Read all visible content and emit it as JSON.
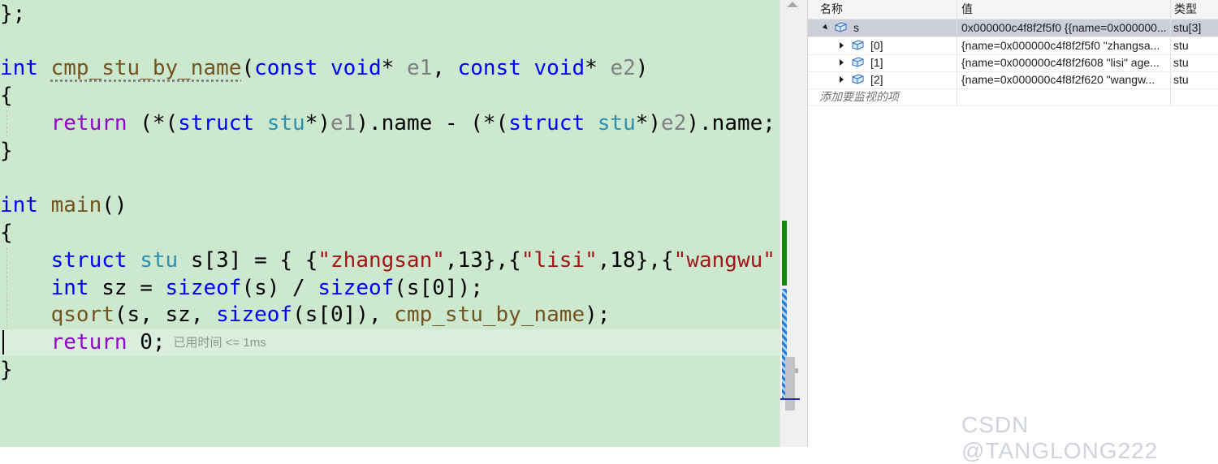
{
  "code": {
    "l0": "};",
    "l2_type": "int",
    "l2_fn": "cmp_stu_by_name",
    "l2_open": "(",
    "l2_const1": "const",
    "l2_void1": "void",
    "l2_star1": "* ",
    "l2_e1": "e1",
    "l2_comma": ", ",
    "l2_const2": "const",
    "l2_void2": "void",
    "l2_star2": "* ",
    "l2_e2": "e2",
    "l2_close": ")",
    "l3": "{",
    "l4_return": "return",
    "l4_a": " (*(",
    "l4_struct1": "struct",
    "l4_stu1": "stu",
    "l4_b": "*)",
    "l4_e1": "e1",
    "l4_c": ").name - (*(",
    "l4_struct2": "struct",
    "l4_stu2": "stu",
    "l4_d": "*)",
    "l4_e2": "e2",
    "l4_e": ").name;",
    "l5": "}",
    "l7_type": "int",
    "l7_fn": "main",
    "l7_rest": "()",
    "l8": "{",
    "l9_struct": "struct",
    "l9_stu": "stu",
    "l9_a": " s[3] = { {",
    "l9_s1": "\"zhangsan\"",
    "l9_b": ",13},{",
    "l9_s2": "\"lisi\"",
    "l9_c": ",18},{",
    "l9_s3": "\"wangwu\"",
    "l10_type": "int",
    "l10_a": " sz = ",
    "l10_sizeof1": "sizeof",
    "l10_b": "(s) / ",
    "l10_sizeof2": "sizeof",
    "l10_c": "(s[0]);",
    "l11_fn": "qsort",
    "l11_a": "(s, sz, ",
    "l11_sizeof": "sizeof",
    "l11_b": "(s[0]), ",
    "l11_cmp": "cmp_stu_by_name",
    "l11_c": ");",
    "l12_return": "return",
    "l12_rest": " 0;",
    "l12_hint": "已用时间 <= 1ms",
    "l13": "}"
  },
  "watch": {
    "columns": {
      "name": "名称",
      "value": "值",
      "type": "类型"
    },
    "rows": [
      {
        "name": "s",
        "value": "0x000000c4f8f2f5f0 {{name=0x000000...",
        "type": "stu[3]"
      },
      {
        "name": "[0]",
        "value": "{name=0x000000c4f8f2f5f0 \"zhangsa...",
        "type": "stu"
      },
      {
        "name": "[1]",
        "value": "{name=0x000000c4f8f2f608 \"lisi\" age...",
        "type": "stu"
      },
      {
        "name": "[2]",
        "value": "{name=0x000000c4f8f2f620 \"wangw...",
        "type": "stu"
      }
    ],
    "add_placeholder": "添加要监视的项"
  },
  "watermark": "CSDN @TANGLONG222",
  "icons": {
    "expand": "triangle-expanded-icon",
    "collapse": "triangle-collapsed-icon",
    "object": "struct-object-icon"
  }
}
